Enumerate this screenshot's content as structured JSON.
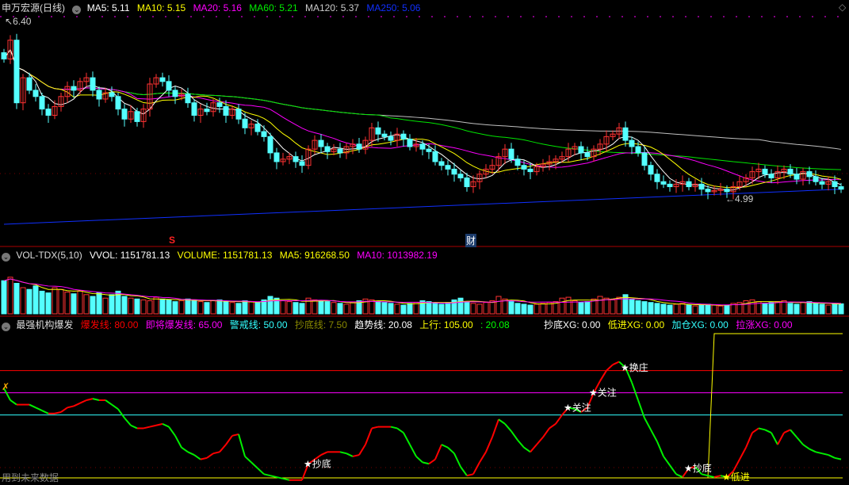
{
  "main_header": {
    "title": "申万宏源(日线)",
    "ma5": "MA5: 5.11",
    "ma10": "MA10: 5.15",
    "ma20": "MA20: 5.16",
    "ma60": "MA60: 5.21",
    "ma120": "MA120: 5.37",
    "ma250": "MA250: 5.06"
  },
  "price_labels": {
    "high": "6.40",
    "low": "4.99"
  },
  "markers": {
    "s": "S",
    "cai": "财"
  },
  "vol_header": {
    "name": "VOL-TDX(5,10)",
    "vvol": "VVOL: 1151781.13",
    "volume": "VOLUME: 1151781.13",
    "ma5": "MA5: 916268.50",
    "ma10": "MA10: 1013982.19"
  },
  "ind_header": {
    "name": "最强机构爆发",
    "l1": "爆发线: 80.00",
    "l2": "即将爆发线: 65.00",
    "l3": "警戒线: 50.00",
    "l4": "抄底线: 7.50",
    "l5": "趋势线: 20.08",
    "l6": "上行: 105.00",
    "l7": ": 20.08",
    "x1": "抄底XG: 0.00",
    "x2": "低进XG: 0.00",
    "x3": "加仓XG: 0.00",
    "x4": "拉涨XG: 0.00"
  },
  "watermark": "用到未来数据",
  "colors": {
    "up": "#ff3232",
    "down": "#54ffff",
    "ma5": "#ffffff",
    "ma10": "#ffff00",
    "ma20": "#ff00ff",
    "ma60": "#00e600",
    "ma120": "#c0c0c0",
    "ma250": "#1030ff"
  },
  "chart_data": {
    "type": "candlestick",
    "closes": [
      6.1,
      6.25,
      5.75,
      5.95,
      5.85,
      5.8,
      5.7,
      5.65,
      5.72,
      5.8,
      5.88,
      5.85,
      5.92,
      5.95,
      5.85,
      5.78,
      5.83,
      5.8,
      5.7,
      5.62,
      5.68,
      5.6,
      5.7,
      5.9,
      5.95,
      5.92,
      5.85,
      5.8,
      5.82,
      5.75,
      5.65,
      5.7,
      5.68,
      5.75,
      5.72,
      5.65,
      5.7,
      5.62,
      5.55,
      5.58,
      5.52,
      5.48,
      5.35,
      5.28,
      5.3,
      5.32,
      5.28,
      5.25,
      5.38,
      5.45,
      5.4,
      5.36,
      5.38,
      5.35,
      5.4,
      5.42,
      5.38,
      5.45,
      5.55,
      5.5,
      5.48,
      5.45,
      5.5,
      5.46,
      5.4,
      5.42,
      5.38,
      5.36,
      5.28,
      5.25,
      5.22,
      5.18,
      5.15,
      5.08,
      5.12,
      5.18,
      5.22,
      5.25,
      5.32,
      5.38,
      5.3,
      5.25,
      5.22,
      5.2,
      5.24,
      5.26,
      5.28,
      5.3,
      5.32,
      5.38,
      5.4,
      5.35,
      5.32,
      5.38,
      5.42,
      5.48,
      5.5,
      5.55,
      5.45,
      5.4,
      5.35,
      5.25,
      5.18,
      5.12,
      5.1,
      5.08,
      5.1,
      5.12,
      5.08,
      5.1,
      5.06,
      5.04,
      5.05,
      5.06,
      5.04,
      5.08,
      5.12,
      5.15,
      5.2,
      5.22,
      5.18,
      5.15,
      5.2,
      5.22,
      5.18,
      5.14,
      5.2,
      5.16,
      5.12,
      5.1,
      5.12,
      5.08,
      5.06
    ],
    "volumes_10k": [
      380,
      420,
      350,
      300,
      280,
      320,
      260,
      240,
      300,
      280,
      250,
      230,
      260,
      220,
      200,
      240,
      180,
      220,
      260,
      200,
      180,
      170,
      160,
      150,
      190,
      170,
      160,
      140,
      150,
      170,
      160,
      140,
      130,
      150,
      160,
      140,
      130,
      120,
      150,
      140,
      130,
      160,
      200,
      180,
      150,
      140,
      130,
      120,
      180,
      160,
      150,
      140,
      130,
      120,
      110,
      130,
      150,
      170,
      160,
      140,
      130,
      120,
      110,
      100,
      120,
      130,
      150,
      140,
      120,
      110,
      130,
      160,
      180,
      140,
      120,
      110,
      130,
      150,
      200,
      170,
      140,
      120,
      110,
      100,
      110,
      120,
      130,
      140,
      180,
      190,
      150,
      130,
      140,
      170,
      200,
      180,
      160,
      190,
      220,
      170,
      150,
      140,
      130,
      120,
      110,
      100,
      110,
      120,
      100,
      90,
      100,
      110,
      100,
      90,
      100,
      120,
      130,
      150,
      160,
      140,
      120,
      130,
      140,
      150,
      120,
      110,
      130,
      140,
      120,
      110,
      100,
      110,
      115
    ],
    "ma250_trend": [
      4.78,
      5.06
    ],
    "price_range": [
      4.7,
      6.52
    ],
    "indicator": {
      "levels": [
        80,
        65,
        50,
        7.5
      ],
      "range": [
        0,
        110
      ],
      "trend": [
        68,
        60,
        57,
        57,
        57,
        55,
        53,
        51,
        51,
        52,
        55,
        56,
        58,
        60,
        61,
        60,
        60,
        57,
        54,
        48,
        43,
        41,
        41,
        42,
        43,
        44,
        42,
        36,
        28,
        25,
        23,
        20,
        21,
        24,
        25,
        30,
        36,
        37,
        22,
        18,
        14,
        10,
        9,
        8,
        7,
        6,
        6,
        6,
        17,
        20,
        23,
        25,
        25,
        25,
        24,
        22,
        23,
        30,
        41,
        42,
        42,
        42,
        41,
        38,
        30,
        22,
        18,
        17,
        20,
        30,
        28,
        24,
        15,
        9,
        10,
        18,
        25,
        35,
        47,
        44,
        39,
        33,
        28,
        25,
        30,
        35,
        41,
        44,
        50,
        55,
        54,
        52,
        55,
        65,
        73,
        80,
        84,
        86,
        82,
        72,
        60,
        48,
        40,
        32,
        22,
        16,
        10,
        8,
        14,
        15,
        10,
        9,
        8,
        9,
        8,
        12,
        20,
        28,
        38,
        41,
        40,
        38,
        30,
        38,
        40,
        35,
        30,
        27,
        25,
        24,
        23,
        21,
        20
      ],
      "upline": {
        "low": 7.5,
        "high": 105,
        "switch_index": 111
      },
      "signals": [
        {
          "i": 48,
          "label": "抄底",
          "color": "#ffffff"
        },
        {
          "i": 89,
          "label": "关注",
          "color": "#ffffff"
        },
        {
          "i": 93,
          "label": "关注",
          "color": "#ffffff"
        },
        {
          "i": 98,
          "label": "换庄",
          "color": "#ffffff"
        },
        {
          "i": 108,
          "label": "抄底",
          "color": "#ffffff"
        },
        {
          "i": 114,
          "label": "低进",
          "color": "#ffff00"
        }
      ]
    }
  }
}
